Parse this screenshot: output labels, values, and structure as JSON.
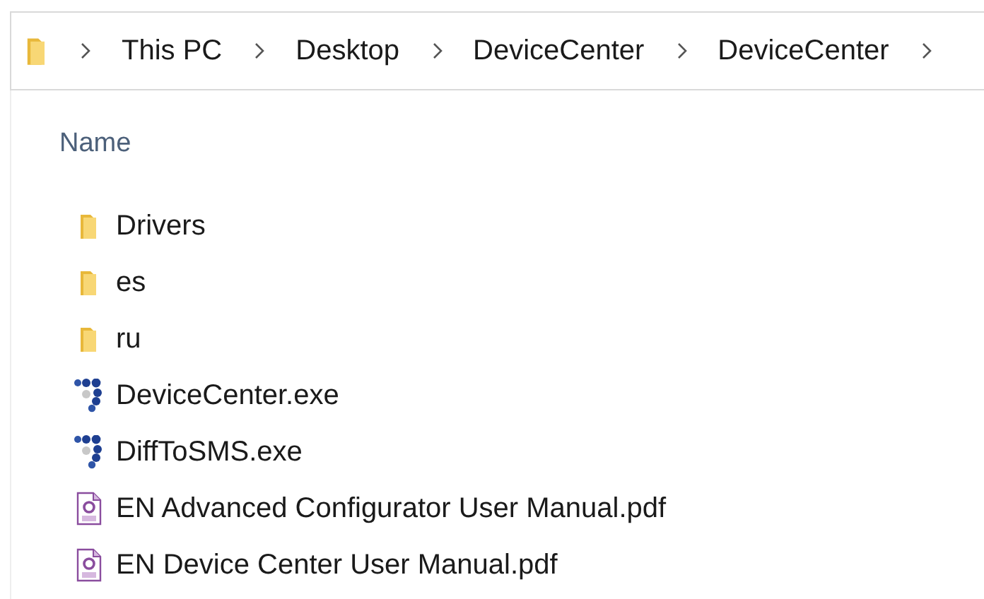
{
  "breadcrumb": [
    {
      "label": "This PC"
    },
    {
      "label": "Desktop"
    },
    {
      "label": "DeviceCenter"
    },
    {
      "label": "DeviceCenter"
    }
  ],
  "columns": [
    {
      "label": "Name"
    }
  ],
  "files": [
    {
      "name": "Drivers",
      "kind": "folder"
    },
    {
      "name": "es",
      "kind": "folder"
    },
    {
      "name": "ru",
      "kind": "folder"
    },
    {
      "name": "DeviceCenter.exe",
      "kind": "exe"
    },
    {
      "name": "DiffToSMS.exe",
      "kind": "exe"
    },
    {
      "name": "EN Advanced Configurator User Manual.pdf",
      "kind": "pdf"
    },
    {
      "name": "EN Device Center User Manual.pdf",
      "kind": "pdf"
    }
  ]
}
